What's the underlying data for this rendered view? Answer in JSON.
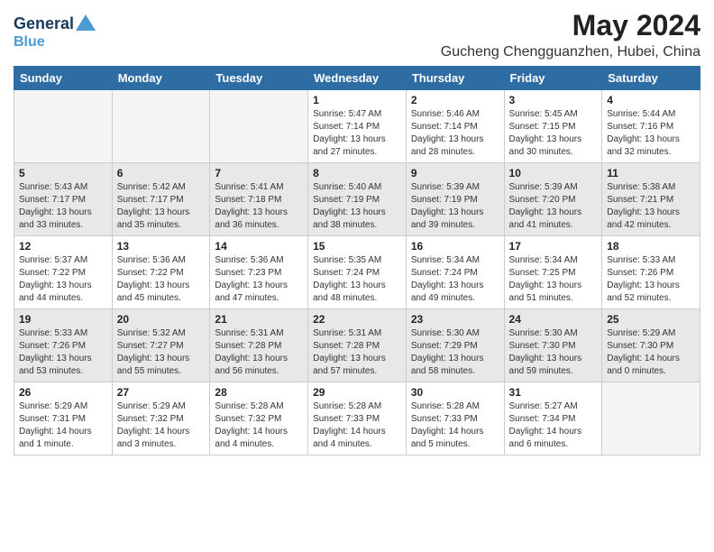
{
  "logo": {
    "line1": "General",
    "line2": "Blue"
  },
  "title": "May 2024",
  "subtitle": "Gucheng Chengguanzhen, Hubei, China",
  "weekdays": [
    "Sunday",
    "Monday",
    "Tuesday",
    "Wednesday",
    "Thursday",
    "Friday",
    "Saturday"
  ],
  "weeks": [
    [
      {
        "day": "",
        "info": ""
      },
      {
        "day": "",
        "info": ""
      },
      {
        "day": "",
        "info": ""
      },
      {
        "day": "1",
        "info": "Sunrise: 5:47 AM\nSunset: 7:14 PM\nDaylight: 13 hours\nand 27 minutes."
      },
      {
        "day": "2",
        "info": "Sunrise: 5:46 AM\nSunset: 7:14 PM\nDaylight: 13 hours\nand 28 minutes."
      },
      {
        "day": "3",
        "info": "Sunrise: 5:45 AM\nSunset: 7:15 PM\nDaylight: 13 hours\nand 30 minutes."
      },
      {
        "day": "4",
        "info": "Sunrise: 5:44 AM\nSunset: 7:16 PM\nDaylight: 13 hours\nand 32 minutes."
      }
    ],
    [
      {
        "day": "5",
        "info": "Sunrise: 5:43 AM\nSunset: 7:17 PM\nDaylight: 13 hours\nand 33 minutes."
      },
      {
        "day": "6",
        "info": "Sunrise: 5:42 AM\nSunset: 7:17 PM\nDaylight: 13 hours\nand 35 minutes."
      },
      {
        "day": "7",
        "info": "Sunrise: 5:41 AM\nSunset: 7:18 PM\nDaylight: 13 hours\nand 36 minutes."
      },
      {
        "day": "8",
        "info": "Sunrise: 5:40 AM\nSunset: 7:19 PM\nDaylight: 13 hours\nand 38 minutes."
      },
      {
        "day": "9",
        "info": "Sunrise: 5:39 AM\nSunset: 7:19 PM\nDaylight: 13 hours\nand 39 minutes."
      },
      {
        "day": "10",
        "info": "Sunrise: 5:39 AM\nSunset: 7:20 PM\nDaylight: 13 hours\nand 41 minutes."
      },
      {
        "day": "11",
        "info": "Sunrise: 5:38 AM\nSunset: 7:21 PM\nDaylight: 13 hours\nand 42 minutes."
      }
    ],
    [
      {
        "day": "12",
        "info": "Sunrise: 5:37 AM\nSunset: 7:22 PM\nDaylight: 13 hours\nand 44 minutes."
      },
      {
        "day": "13",
        "info": "Sunrise: 5:36 AM\nSunset: 7:22 PM\nDaylight: 13 hours\nand 45 minutes."
      },
      {
        "day": "14",
        "info": "Sunrise: 5:36 AM\nSunset: 7:23 PM\nDaylight: 13 hours\nand 47 minutes."
      },
      {
        "day": "15",
        "info": "Sunrise: 5:35 AM\nSunset: 7:24 PM\nDaylight: 13 hours\nand 48 minutes."
      },
      {
        "day": "16",
        "info": "Sunrise: 5:34 AM\nSunset: 7:24 PM\nDaylight: 13 hours\nand 49 minutes."
      },
      {
        "day": "17",
        "info": "Sunrise: 5:34 AM\nSunset: 7:25 PM\nDaylight: 13 hours\nand 51 minutes."
      },
      {
        "day": "18",
        "info": "Sunrise: 5:33 AM\nSunset: 7:26 PM\nDaylight: 13 hours\nand 52 minutes."
      }
    ],
    [
      {
        "day": "19",
        "info": "Sunrise: 5:33 AM\nSunset: 7:26 PM\nDaylight: 13 hours\nand 53 minutes."
      },
      {
        "day": "20",
        "info": "Sunrise: 5:32 AM\nSunset: 7:27 PM\nDaylight: 13 hours\nand 55 minutes."
      },
      {
        "day": "21",
        "info": "Sunrise: 5:31 AM\nSunset: 7:28 PM\nDaylight: 13 hours\nand 56 minutes."
      },
      {
        "day": "22",
        "info": "Sunrise: 5:31 AM\nSunset: 7:28 PM\nDaylight: 13 hours\nand 57 minutes."
      },
      {
        "day": "23",
        "info": "Sunrise: 5:30 AM\nSunset: 7:29 PM\nDaylight: 13 hours\nand 58 minutes."
      },
      {
        "day": "24",
        "info": "Sunrise: 5:30 AM\nSunset: 7:30 PM\nDaylight: 13 hours\nand 59 minutes."
      },
      {
        "day": "25",
        "info": "Sunrise: 5:29 AM\nSunset: 7:30 PM\nDaylight: 14 hours\nand 0 minutes."
      }
    ],
    [
      {
        "day": "26",
        "info": "Sunrise: 5:29 AM\nSunset: 7:31 PM\nDaylight: 14 hours\nand 1 minute."
      },
      {
        "day": "27",
        "info": "Sunrise: 5:29 AM\nSunset: 7:32 PM\nDaylight: 14 hours\nand 3 minutes."
      },
      {
        "day": "28",
        "info": "Sunrise: 5:28 AM\nSunset: 7:32 PM\nDaylight: 14 hours\nand 4 minutes."
      },
      {
        "day": "29",
        "info": "Sunrise: 5:28 AM\nSunset: 7:33 PM\nDaylight: 14 hours\nand 4 minutes."
      },
      {
        "day": "30",
        "info": "Sunrise: 5:28 AM\nSunset: 7:33 PM\nDaylight: 14 hours\nand 5 minutes."
      },
      {
        "day": "31",
        "info": "Sunrise: 5:27 AM\nSunset: 7:34 PM\nDaylight: 14 hours\nand 6 minutes."
      },
      {
        "day": "",
        "info": ""
      }
    ]
  ]
}
